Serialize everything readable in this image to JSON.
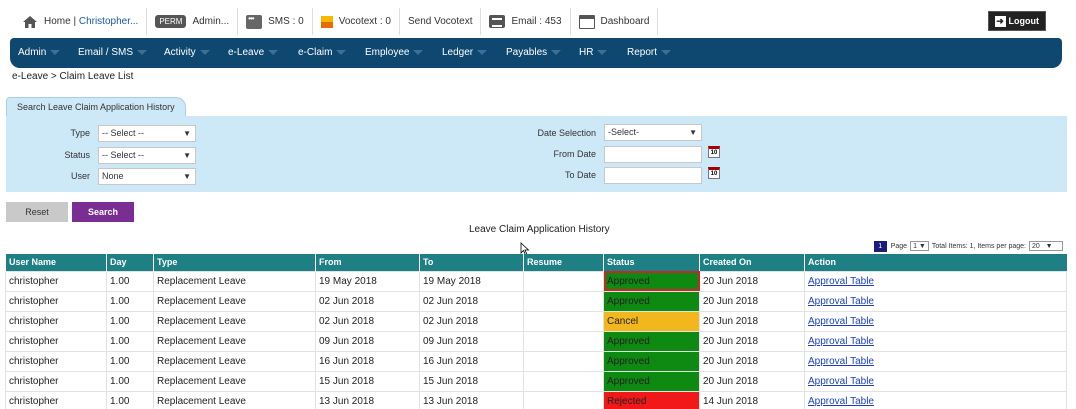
{
  "topbar": {
    "home_prefix": "Home | ",
    "home_user": "Christopher...",
    "perm_badge": "PERM",
    "admin": "Admin...",
    "sms": "SMS : 0",
    "vocotext": "Vocotext : 0",
    "send_vocotext": "Send Vocotext",
    "email": "Email : 453",
    "dashboard": "Dashboard",
    "logout": "Logout"
  },
  "nav": [
    "Admin",
    "Email / SMS",
    "Activity",
    "e-Leave",
    "e-Claim",
    "Employee",
    "Ledger",
    "Payables",
    "HR",
    "Report"
  ],
  "breadcrumb": "e-Leave > Claim Leave List",
  "search": {
    "tab_label": "Search Leave Claim Application History",
    "type_label": "Type",
    "type_value": "-- Select --",
    "status_label": "Status",
    "status_value": "-- Select --",
    "user_label": "User",
    "user_value": "None",
    "date_selection_label": "Date Selection",
    "date_selection_value": "-Select-",
    "from_date_label": "From Date",
    "to_date_label": "To Date",
    "calendar_glyph": "10",
    "reset_label": "Reset",
    "search_label": "Search"
  },
  "table": {
    "title": "Leave Claim Application History",
    "pager": {
      "page_num": "1",
      "page_label": "Page",
      "page_value": "1",
      "total_items": "Total Items: 1, Items per page:",
      "per_page": "20"
    },
    "columns": [
      "User Name",
      "Day",
      "Type",
      "From",
      "To",
      "Resume",
      "Status",
      "Created On",
      "Action"
    ],
    "rows": [
      {
        "user": "christopher",
        "day": "1.00",
        "type": "Replacement Leave",
        "from": "19 May 2018",
        "to": "19 May 2018",
        "resume": "",
        "status": "Approved",
        "created": "20 Jun 2018",
        "action": "Approval Table"
      },
      {
        "user": "christopher",
        "day": "1.00",
        "type": "Replacement Leave",
        "from": "02 Jun 2018",
        "to": "02 Jun 2018",
        "resume": "",
        "status": "Approved",
        "created": "20 Jun 2018",
        "action": "Approval Table"
      },
      {
        "user": "christopher",
        "day": "1.00",
        "type": "Replacement Leave",
        "from": "02 Jun 2018",
        "to": "02 Jun 2018",
        "resume": "",
        "status": "Cancel",
        "created": "20 Jun 2018",
        "action": "Approval Table"
      },
      {
        "user": "christopher",
        "day": "1.00",
        "type": "Replacement Leave",
        "from": "09 Jun 2018",
        "to": "09 Jun 2018",
        "resume": "",
        "status": "Approved",
        "created": "20 Jun 2018",
        "action": "Approval Table"
      },
      {
        "user": "christopher",
        "day": "1.00",
        "type": "Replacement Leave",
        "from": "16 Jun 2018",
        "to": "16 Jun 2018",
        "resume": "",
        "status": "Approved",
        "created": "20 Jun 2018",
        "action": "Approval Table"
      },
      {
        "user": "christopher",
        "day": "1.00",
        "type": "Replacement Leave",
        "from": "15 Jun 2018",
        "to": "15 Jun 2018",
        "resume": "",
        "status": "Approved",
        "created": "20 Jun 2018",
        "action": "Approval Table"
      },
      {
        "user": "christopher",
        "day": "1.00",
        "type": "Replacement Leave",
        "from": "13 Jun 2018",
        "to": "13 Jun 2018",
        "resume": "",
        "status": "Rejected",
        "created": "14 Jun 2018",
        "action": "Approval Table"
      }
    ]
  },
  "colors": {
    "nav_bg": "#0e4770",
    "header_bg": "#1e7f84",
    "approved": "#0e8a12",
    "cancel": "#f2b71d",
    "rejected": "#f01818",
    "search_btn": "#7a2e94"
  }
}
